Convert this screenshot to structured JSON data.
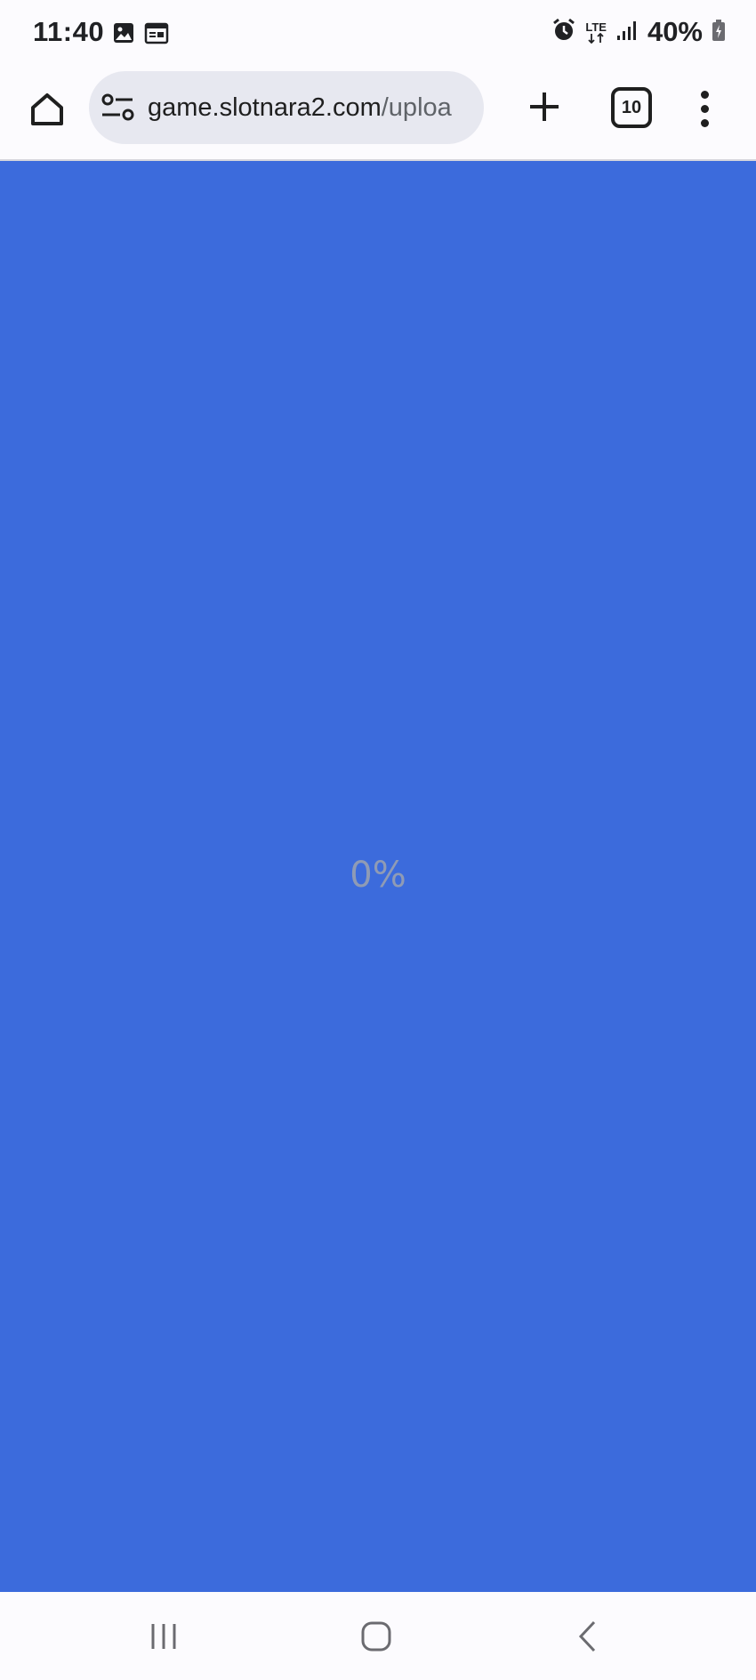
{
  "status_bar": {
    "time": "11:40",
    "network": "LTE",
    "battery": "40%",
    "icons": [
      "image-icon",
      "calendar-icon",
      "alarm-icon",
      "lte-icon",
      "signal-icon",
      "battery-icon"
    ]
  },
  "browser": {
    "url_main": "game.slotnara2.com",
    "url_rest": "/uploa",
    "tab_count": "10",
    "icons": [
      "home-icon",
      "site-settings-icon",
      "plus-icon",
      "more-vert-icon"
    ]
  },
  "page": {
    "background_color": "#3c6bdc",
    "progress": "0%"
  },
  "nav": {
    "icons": [
      "recents-icon",
      "home-circle-icon",
      "back-icon"
    ]
  }
}
